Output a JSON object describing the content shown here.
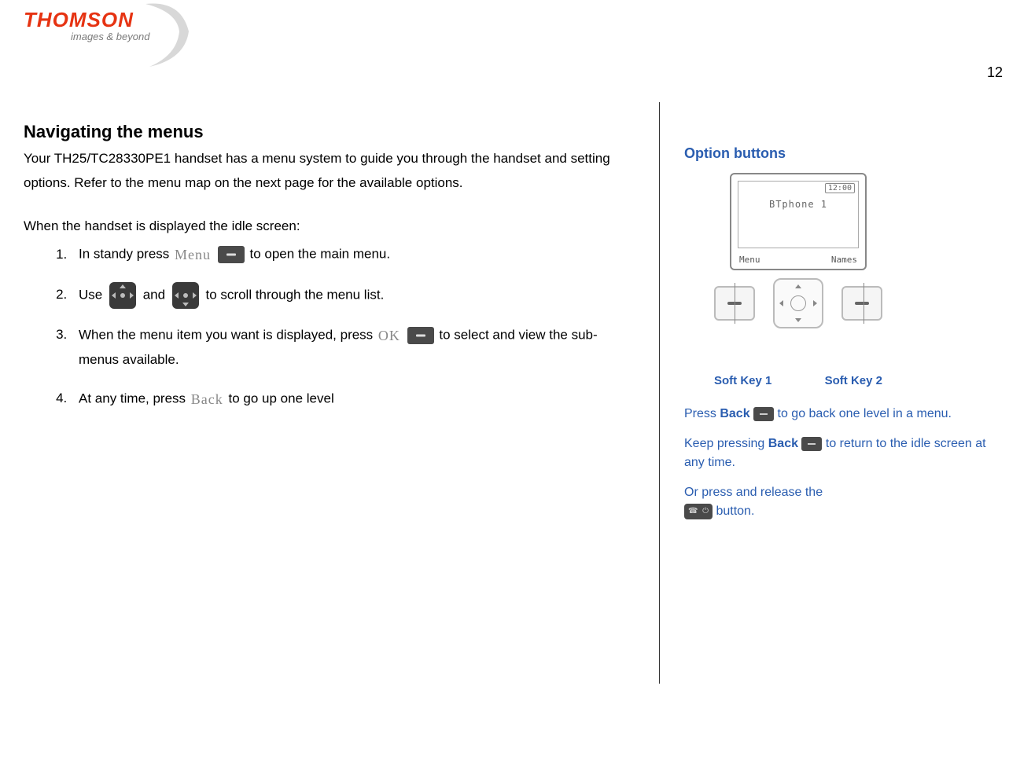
{
  "logo": {
    "brand": "THOMSON",
    "tagline": "images & beyond"
  },
  "page_number": "12",
  "section": {
    "title": "Navigating the menus",
    "intro": "Your TH25/TC28330PE1 handset has a menu system to guide you through the handset and setting options.  Refer to the menu map on the next page for the available options.",
    "when_text": "When the handset is displayed the idle screen:",
    "steps": {
      "s1_a": "In standy press ",
      "s1_label": "Menu",
      "s1_b": "to open the main menu.",
      "s2_a": "Use ",
      "s2_b": " and ",
      "s2_c": " to scroll through the menu list.",
      "s3_a": "When the menu item you want is displayed, press ",
      "s3_label": "OK",
      "s3_b": "to select and view the sub-menus available.",
      "s4_a": "At any time, press ",
      "s4_label": "Back",
      "s4_b": " to go up one level"
    }
  },
  "sidebar": {
    "title": "Option buttons",
    "screen": {
      "time": "12:00",
      "main": "BTphone   1",
      "left_softkey": "Menu",
      "right_softkey": "Names"
    },
    "softkey1_label": "Soft Key 1",
    "softkey2_label": "Soft Key 2",
    "tip1_a": "Press ",
    "tip1_bold": "Back",
    "tip1_b": " to go back one level in a menu.",
    "tip2_a": "Keep pressing ",
    "tip2_bold": "Back",
    "tip2_b": " to return to the idle screen at any time.",
    "tip3_a": "Or press and release the",
    "tip3_b": " button."
  }
}
